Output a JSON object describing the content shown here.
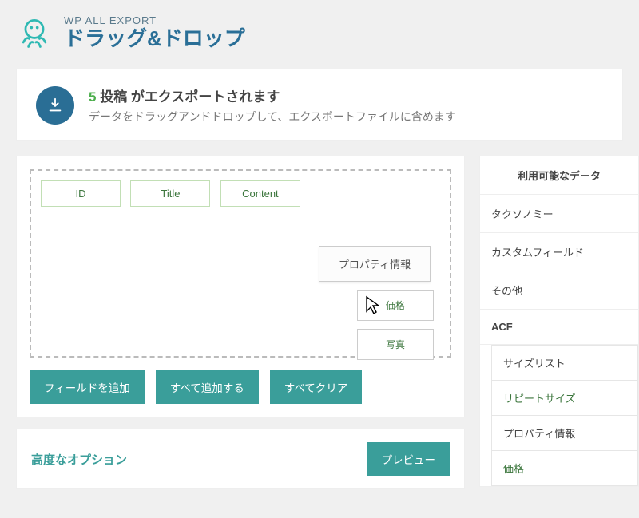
{
  "brand": "WP ALL EXPORT",
  "page_title": "ドラッグ&ドロップ",
  "info": {
    "count": "5",
    "count_suffix": "投稿 がエクスポートされます",
    "subtitle": "データをドラッグアンドドロップして、エクスポートファイルに含めます"
  },
  "dropzone": {
    "fields": [
      "ID",
      "Title",
      "Content"
    ],
    "dragging": {
      "parent": "プロパティ情報",
      "children": [
        "価格",
        "写真"
      ]
    }
  },
  "buttons": {
    "add_field": "フィールドを追加",
    "add_all": "すべて追加する",
    "clear_all": "すべてクリア",
    "preview": "プレビュー"
  },
  "advanced_title": "高度なオプション",
  "sidebar": {
    "header": "利用可能なデータ",
    "items": [
      {
        "label": "タクソノミー",
        "type": "cat"
      },
      {
        "label": "カスタムフィールド",
        "type": "cat"
      },
      {
        "label": "その他",
        "type": "cat"
      },
      {
        "label": "ACF",
        "type": "cat-strong"
      },
      {
        "label": "サイズリスト",
        "type": "sub"
      },
      {
        "label": "リピートサイズ",
        "type": "sub-sel"
      },
      {
        "label": "プロパティ情報",
        "type": "sub"
      },
      {
        "label": "価格",
        "type": "sub-sel"
      }
    ]
  }
}
